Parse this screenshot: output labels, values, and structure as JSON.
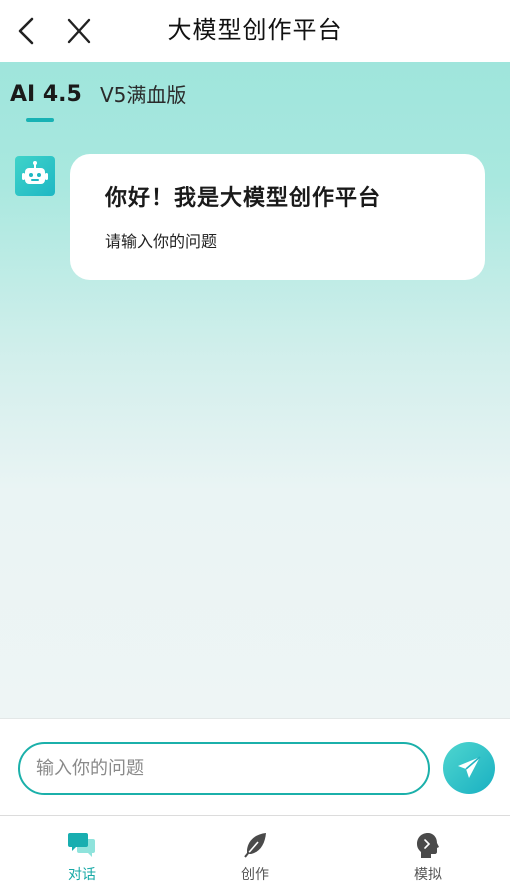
{
  "header": {
    "title": "大模型创作平台"
  },
  "model_tabs": [
    {
      "label": "AI 4.5",
      "active": true
    },
    {
      "label": "V5满血版",
      "active": false
    }
  ],
  "chat": {
    "greeting": "你好！我是大模型创作平台",
    "prompt": "请输入你的问题"
  },
  "input": {
    "placeholder": "输入你的问题"
  },
  "bottom_nav": [
    {
      "label": "对话",
      "icon": "chat-bubbles-icon",
      "active": true
    },
    {
      "label": "创作",
      "icon": "feather-icon",
      "active": false
    },
    {
      "label": "模拟",
      "icon": "head-profile-icon",
      "active": false
    }
  ],
  "colors": {
    "accent": "#18b2b4",
    "active_nav_text": "#17a9a6",
    "gradient_top": "#9fe5dc"
  }
}
